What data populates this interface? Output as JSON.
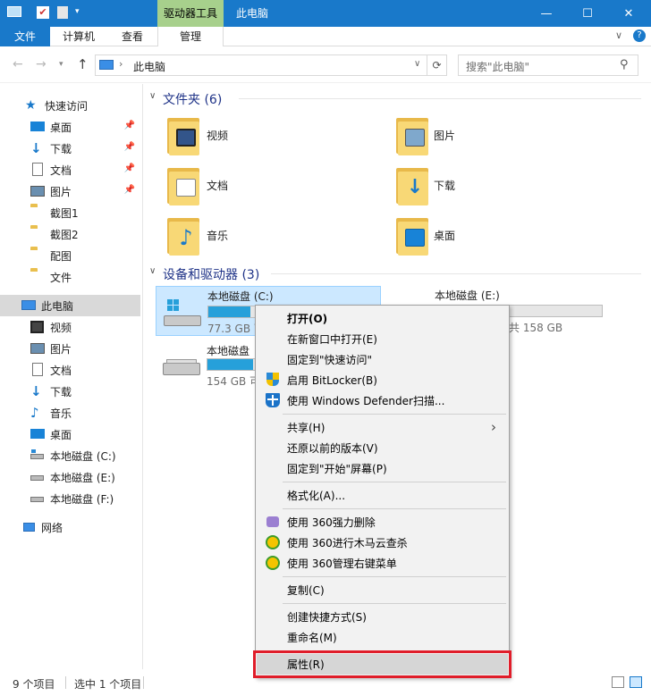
{
  "window": {
    "title": "此电脑",
    "contextual_tab": "驱动器工具",
    "minimize": "—",
    "maximize": "☐",
    "close": "✕"
  },
  "ribbon": {
    "tabs": [
      "文件",
      "计算机",
      "查看",
      "管理"
    ],
    "collapse": "∨",
    "help": "?"
  },
  "address": {
    "path": "此电脑",
    "search_placeholder": "搜索\"此电脑\""
  },
  "nav": {
    "quick_access": "快速访问",
    "quick_items": [
      "桌面",
      "下载",
      "文档",
      "图片",
      "截图1",
      "截图2",
      "配图",
      "文件"
    ],
    "this_pc": "此电脑",
    "pc_items": [
      "视频",
      "图片",
      "文档",
      "下载",
      "音乐",
      "桌面",
      "本地磁盘 (C:)",
      "本地磁盘 (E:)",
      "本地磁盘 (F:)"
    ],
    "network": "网络"
  },
  "main": {
    "folders_header": "文件夹 (6)",
    "folders": [
      "视频",
      "图片",
      "文档",
      "下载",
      "音乐",
      "桌面"
    ],
    "devices_header": "设备和驱动器 (3)",
    "drives": [
      {
        "name": "本地磁盘 (C:)",
        "space": "77.3 GB 可",
        "used": 0.25
      },
      {
        "name": "本地磁盘 (E:)",
        "space": "共 158 GB",
        "used": 0.0
      },
      {
        "name": "本地磁盘",
        "space": "154 GB 可",
        "used": 0.2
      }
    ]
  },
  "context_menu": {
    "items": [
      "打开(O)",
      "在新窗口中打开(E)",
      "固定到\"快速访问\"",
      "启用 BitLocker(B)",
      "使用 Windows Defender扫描...",
      "共享(H)",
      "还原以前的版本(V)",
      "固定到\"开始\"屏幕(P)",
      "格式化(A)...",
      "使用 360强力删除",
      "使用 360进行木马云查杀",
      "使用 360管理右键菜单",
      "复制(C)",
      "创建快捷方式(S)",
      "重命名(M)",
      "属性(R)"
    ],
    "submenu_arrow": "›"
  },
  "status": {
    "count": "9 个项目",
    "selected": "选中 1 个项目"
  },
  "colors": {
    "titlebar": "#1979ca",
    "highlight_box": "#e01d2a",
    "selection": "#cce8ff",
    "drive_bar": "#26a0da"
  }
}
